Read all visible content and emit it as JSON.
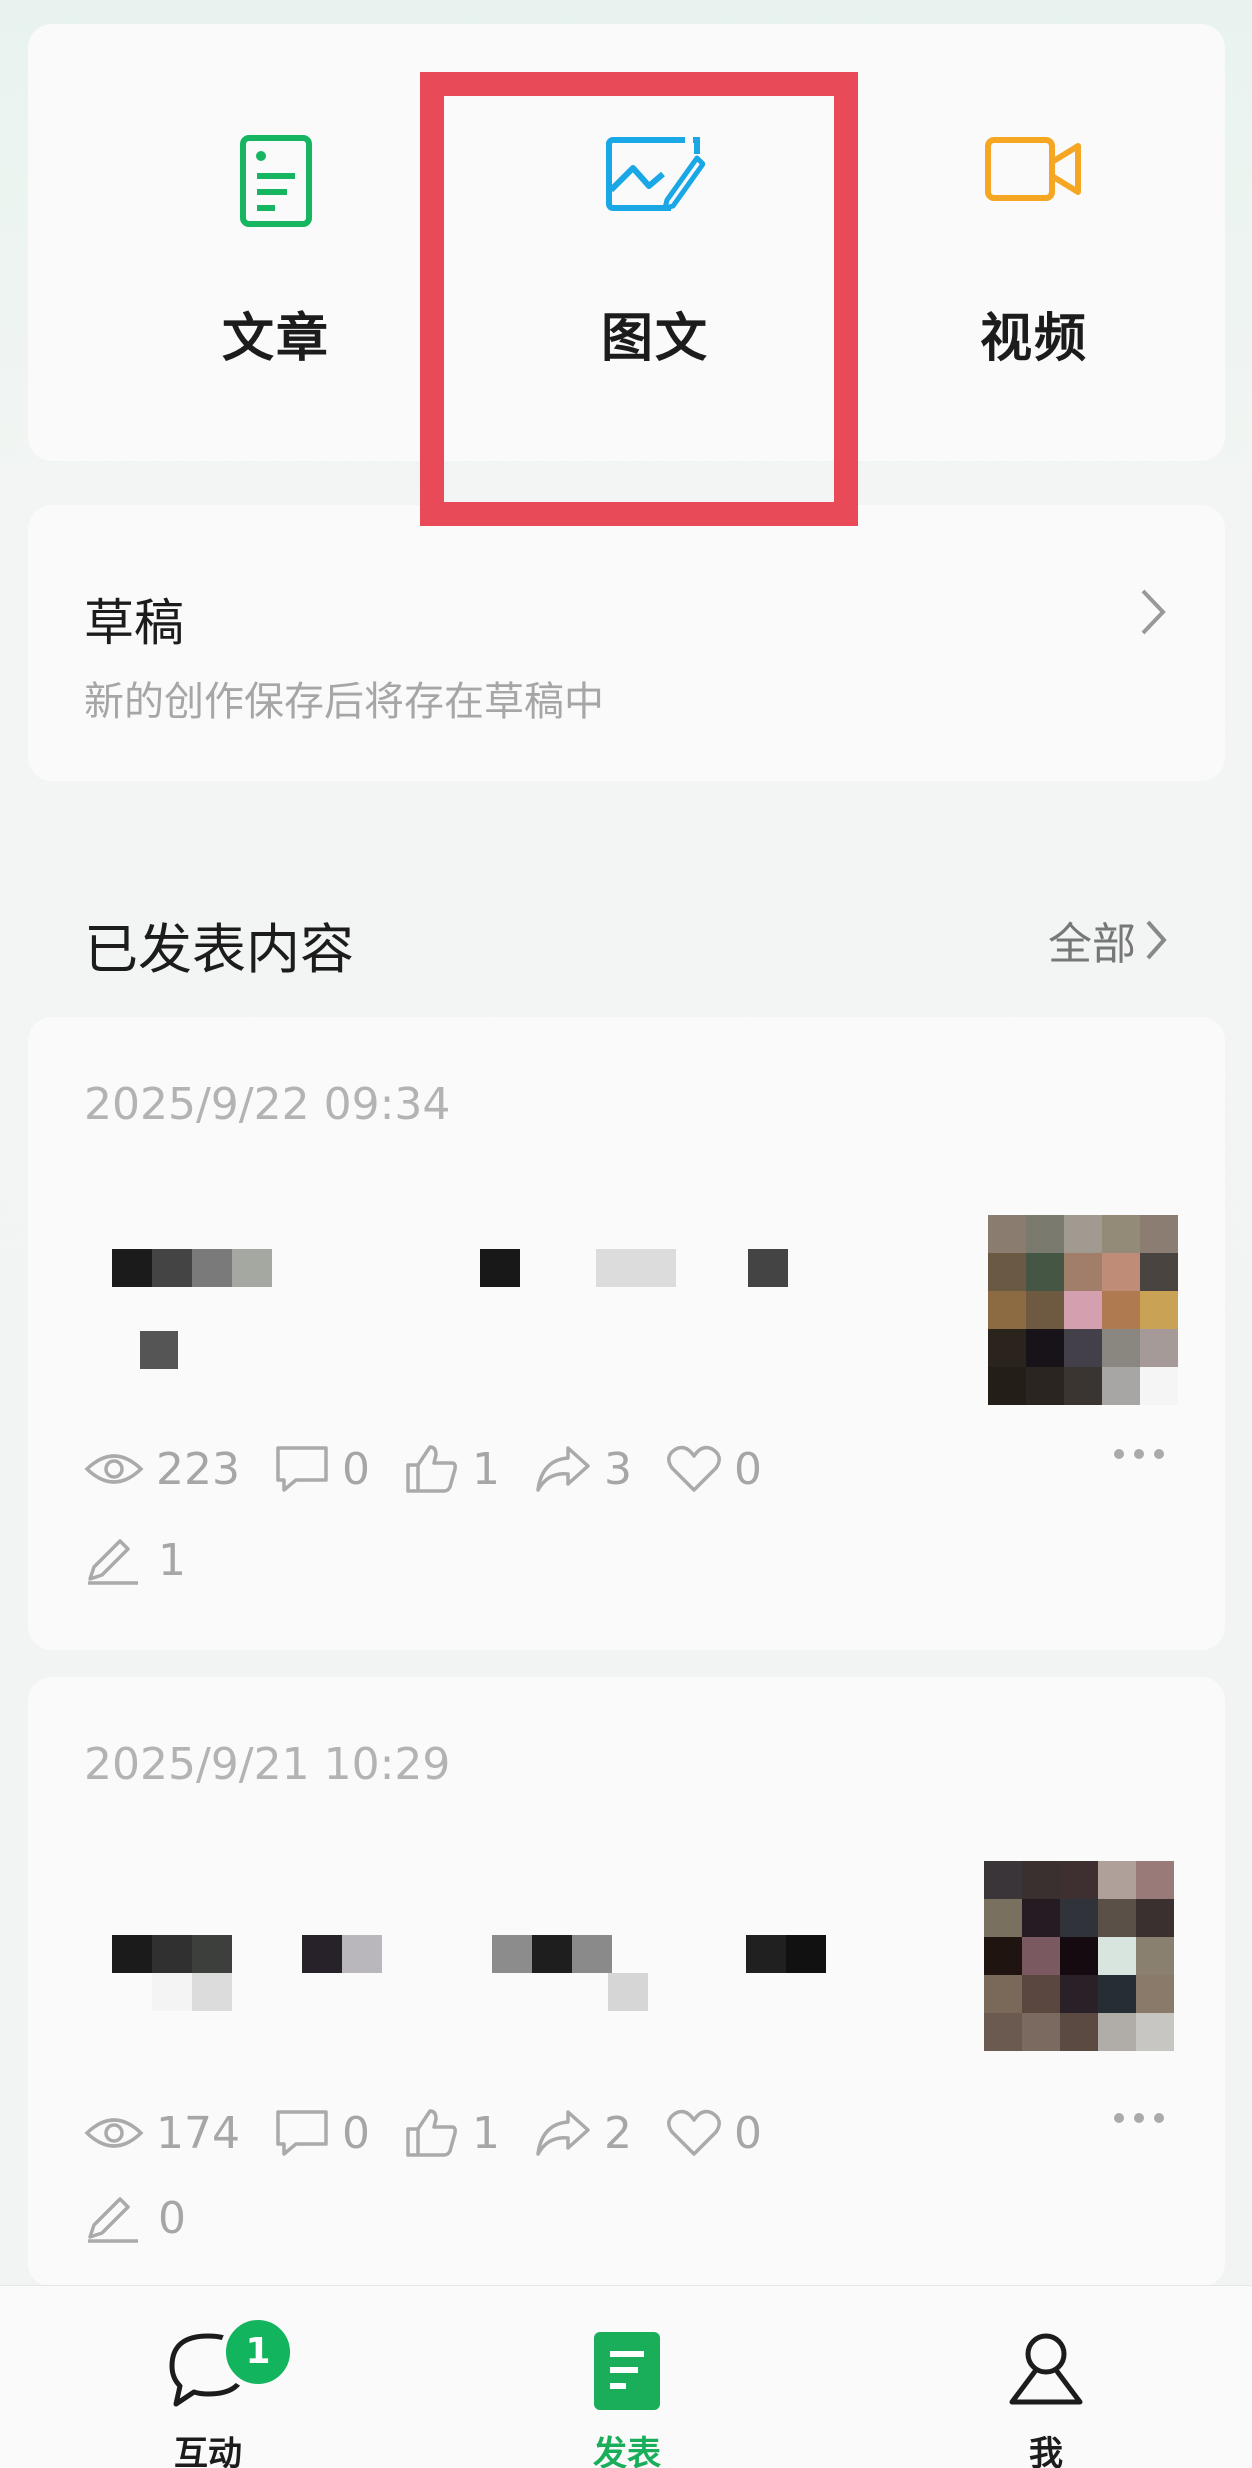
{
  "create": {
    "items": [
      {
        "label": "文章",
        "icon": "article-icon"
      },
      {
        "label": "图文",
        "icon": "image-text-icon"
      },
      {
        "label": "视频",
        "icon": "video-icon"
      }
    ]
  },
  "drafts": {
    "title": "草稿",
    "subtitle": "新的创作保存后将存在草稿中"
  },
  "published": {
    "title": "已发表内容",
    "all_label": "全部"
  },
  "posts": [
    {
      "date": "2025/9/22 09:34",
      "views": "223",
      "comments": "0",
      "likes": "1",
      "shares": "3",
      "favorites": "0",
      "edits": "1"
    },
    {
      "date": "2025/9/21 10:29",
      "views": "174",
      "comments": "0",
      "likes": "1",
      "shares": "2",
      "favorites": "0",
      "edits": "0"
    }
  ],
  "nav": {
    "items": [
      {
        "label": "互动",
        "icon": "chat-icon",
        "badge": "1"
      },
      {
        "label": "发表",
        "icon": "publish-icon"
      },
      {
        "label": "我",
        "icon": "profile-icon"
      }
    ]
  },
  "colors": {
    "accent_green": "#1aad5a",
    "article_icon": "#15b562",
    "image_icon": "#1aa7e6",
    "video_icon": "#f5a623",
    "highlight": "#e94a57"
  }
}
